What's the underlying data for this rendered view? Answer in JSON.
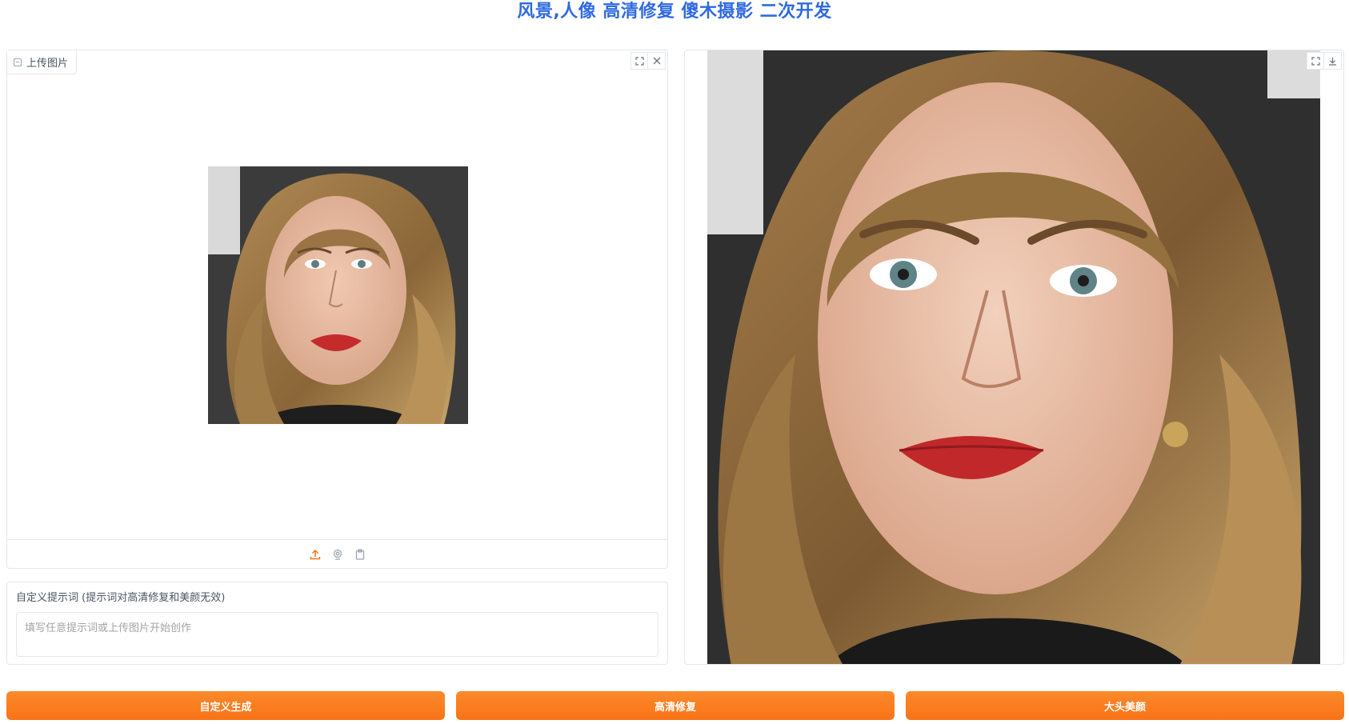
{
  "page": {
    "title": "风景,人像 高清修复 傻木摄影 二次开发"
  },
  "upload": {
    "label": "上传图片",
    "label_icon": "image-icon",
    "tools": {
      "fullscreen_icon": "expand-icon",
      "clear_icon": "close-icon"
    },
    "sources": [
      {
        "icon": "upload-icon",
        "active": true
      },
      {
        "icon": "webcam-icon",
        "active": false
      },
      {
        "icon": "clipboard-icon",
        "active": false
      }
    ]
  },
  "prompt": {
    "label": "自定义提示词 (提示词对高清修复和美颜无效)",
    "placeholder": "填写任意提示词或上传图片开始创作",
    "value": ""
  },
  "output": {
    "tools": {
      "fullscreen_icon": "expand-icon",
      "download_icon": "download-icon"
    }
  },
  "actions": {
    "custom_generate": "自定义生成",
    "hd_restore": "高清修复",
    "big_head_beauty": "大头美颜"
  },
  "colors": {
    "accent": "#f97316",
    "title": "#2f6ae0",
    "border": "#e5e7eb"
  }
}
